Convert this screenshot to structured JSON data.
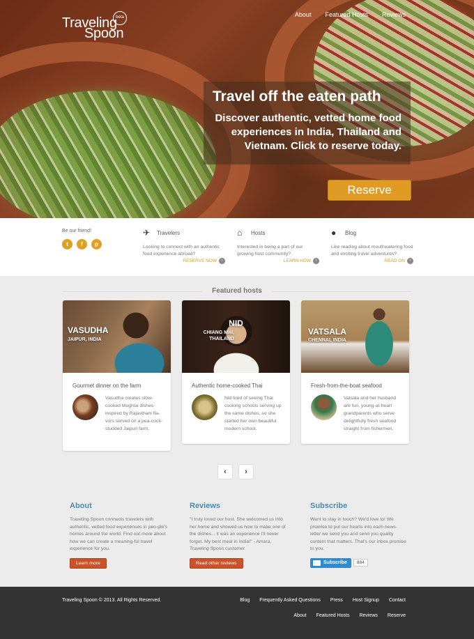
{
  "header": {
    "logo_line1": "Traveling",
    "logo_line2": "Spoon",
    "logo_badge": "beta",
    "nav": [
      "About",
      "Featured Hosts",
      "Reviews"
    ]
  },
  "hero": {
    "title": "Travel off the eaten path",
    "subtitle": "Discover authentic, vetted home food experiences in India, Thailand and Vietnam. Click to reserve today.",
    "reserve_label": "Reserve"
  },
  "strip": {
    "friend_label": "Be our friend!",
    "social": [
      {
        "icon": "twitter-icon",
        "glyph": "t"
      },
      {
        "icon": "facebook-icon",
        "glyph": "f"
      },
      {
        "icon": "pinterest-icon",
        "glyph": "p"
      }
    ],
    "columns": [
      {
        "icon": "airplane-icon",
        "title": "Travelers",
        "desc": "Looking to connect with an authentic food experience abroad?",
        "link": "RESERVE NOW"
      },
      {
        "icon": "house-icon",
        "title": "Hosts",
        "desc": "Interested in being a part of our growing host community?",
        "link": "LEARN HOW"
      },
      {
        "icon": "speech-bubble-icon",
        "title": "Blog",
        "desc": "Like reading about mouthwatering food and exciting travel adventures?",
        "link": "READ ON"
      }
    ]
  },
  "featured": {
    "title": "Featured hosts",
    "hosts": [
      {
        "name": "VASUDHA",
        "location": "JAIPUR, INDIA",
        "headline": "Gourmet dinner on the farm",
        "text": "Vasudha creates slow-cooked Mughlai dishes inspired by Rajasthani fla-vors served on a pea-cock-studded Jaipuri farm."
      },
      {
        "name": "NID",
        "location": "CHIANG MAI, THAILAND",
        "headline": "Authentic home-cooked Thai",
        "text": "Nid tired of seeing Thai cooking schools serving up the same dishes, so she started her own beautiful modern school."
      },
      {
        "name": "VATSALA",
        "location": "CHENNAI, INDIA",
        "headline": "Fresh-from-the-boat seafood",
        "text": "Vatsala and her husband are fun, young-at-heart grandparents who serve delightfully fresh seafood straight from fishermen."
      }
    ]
  },
  "about": {
    "title": "About",
    "text": "Traveling Spoon connects travelers with authentic, vetted food experiences in peo-ple's homes around the world. Find out more about how we can create a meaning-ful travel experience for you.",
    "button": "Learn more"
  },
  "reviews": {
    "title": "Reviews",
    "text": "\"I truly loved our host. She welcomed us into her home and showed us how to make one of the dishes... it was an experience I'll never forget. My best meal in India!\" - Amara, Traveling Spoon customer",
    "button": "Read other reviews"
  },
  "subscribe": {
    "title": "Subscribe",
    "text": "Want to stay in touch? We'd love to! We promise to put our hearts into each news-letter we send you and send you quality content that matters. That's our inbox promise to you.",
    "button": "Subscribe",
    "count": "884"
  },
  "footer": {
    "copyright": "Traveling Spoon © 2013. All Rights Reserved.",
    "row1": [
      "Blog",
      "Frequently Asked Questions",
      "Press",
      "Host Signup",
      "Contact"
    ],
    "row2": [
      "About",
      "Featured Hosts",
      "Reviews",
      "Reserve"
    ]
  }
}
